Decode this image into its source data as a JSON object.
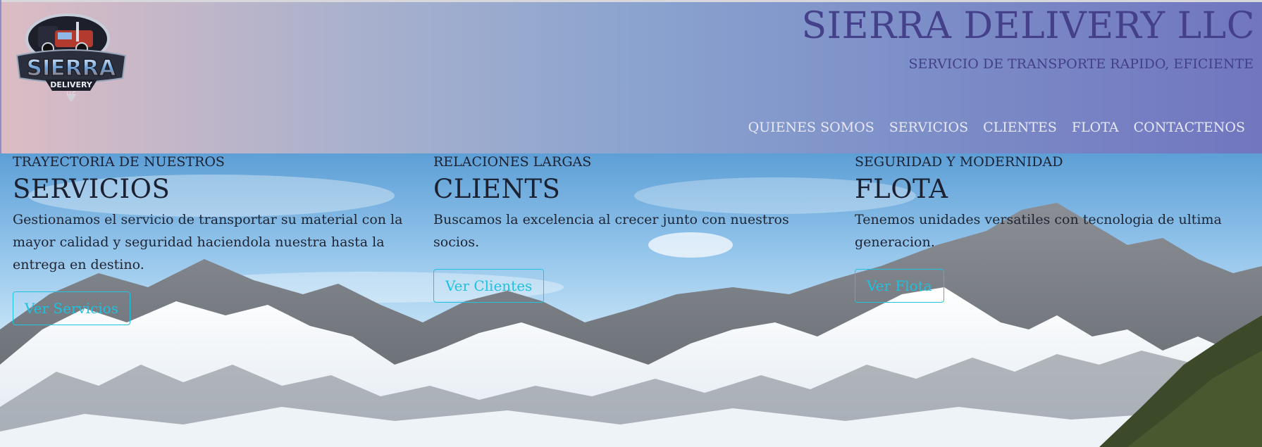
{
  "brand": {
    "logo_text": "SIERRA",
    "logo_subtext": "DELIVERY",
    "logo_llc": "LLC",
    "title": "SIERRA DELIVERY LLC",
    "tagline": "SERVICIO DE TRANSPORTE RAPIDO, EFICIENTE"
  },
  "nav": {
    "items": [
      {
        "label": "QUIENES SOMOS"
      },
      {
        "label": "SERVICIOS"
      },
      {
        "label": "CLIENTES"
      },
      {
        "label": "FLOTA"
      },
      {
        "label": "CONTACTENOS"
      }
    ]
  },
  "features": [
    {
      "eyebrow": "TRAYECTORIA DE NUESTROS",
      "heading": "SERVICIOS",
      "text": "Gestionamos el servicio de transportar su material con la mayor calidad y seguridad haciendola nuestra hasta la entrega en destino.",
      "button": "Ver Servicios"
    },
    {
      "eyebrow": "RELACIONES LARGAS",
      "heading": "CLIENTS",
      "text": "Buscamos la excelencia al crecer junto con nuestros socios.",
      "button": "Ver Clientes"
    },
    {
      "eyebrow": "SEGURIDAD Y MODERNIDAD",
      "heading": "FLOTA",
      "text": "Tenemos unidades versatiles con tecnologia de ultima generacion.",
      "button": "Ver Flota"
    }
  ],
  "colors": {
    "title": "#45408a",
    "nav_text": "#e7e8f4",
    "button_accent": "#21c3e0",
    "header_gradient_start": "#dcbcc4",
    "header_gradient_end": "#7176bf"
  }
}
